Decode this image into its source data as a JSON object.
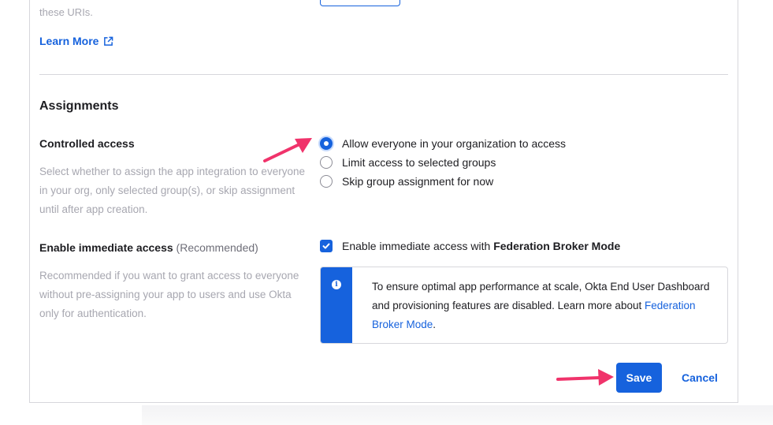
{
  "previous_section": {
    "uris_text": "these URIs.",
    "learn_more_label": "Learn More",
    "external_link_icon": "external-link-icon"
  },
  "assignments": {
    "title": "Assignments",
    "controlled_access": {
      "label": "Controlled access",
      "help": "Select whether to assign the app integration to everyone in your org, only selected group(s), or skip assignment until after app creation.",
      "options": [
        {
          "label": "Allow everyone in your organization to access",
          "checked": true
        },
        {
          "label": "Limit access to selected groups",
          "checked": false
        },
        {
          "label": "Skip group assignment for now",
          "checked": false
        }
      ]
    },
    "immediate_access": {
      "label": "Enable immediate access",
      "note": "(Recommended)",
      "help": "Recommended if you want to grant access to everyone without pre-assigning your app to users and use Okta only for authentication.",
      "checkbox_prefix": "Enable immediate access with ",
      "checkbox_bold": "Federation Broker Mode",
      "checked": true
    },
    "callout": {
      "icon": "info-icon",
      "text": "To ensure optimal app performance at scale, Okta End User Dashboard and provisioning features are disabled. Learn more about ",
      "link": "Federation Broker Mode",
      "suffix": "."
    }
  },
  "actions": {
    "save_label": "Save",
    "cancel_label": "Cancel"
  },
  "colors": {
    "accent": "#1662dd",
    "annotation_arrow": "#f0336b"
  }
}
